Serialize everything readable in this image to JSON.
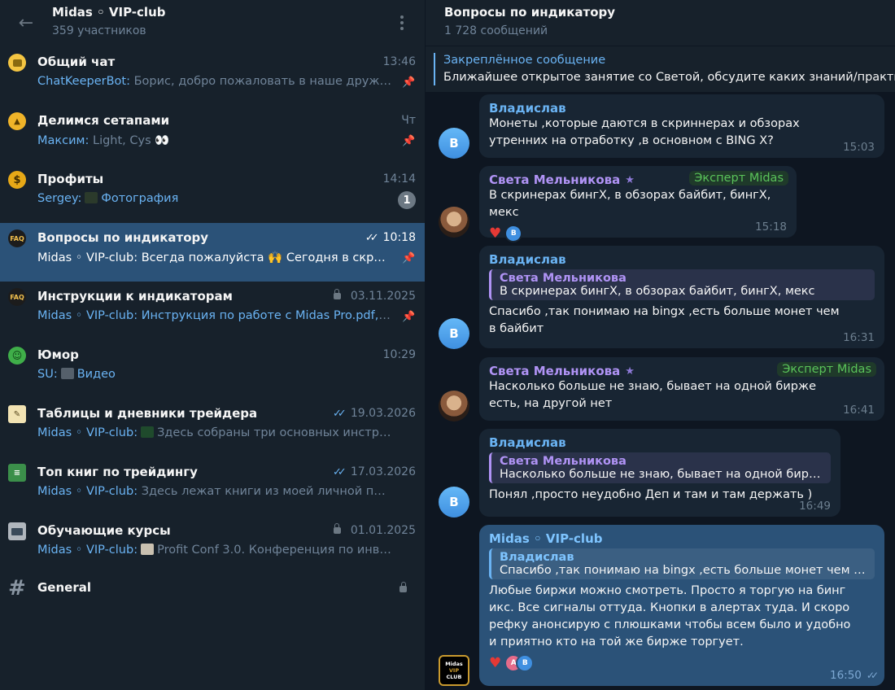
{
  "group": {
    "title": "Midas ◦ VIP-club",
    "members": "359 участников"
  },
  "topics": [
    {
      "icon": "speech-bubble-icon",
      "title": "Общий чат",
      "time": "13:46",
      "sender": "ChatKeeperBot:",
      "text": " Борис, добро пожаловать в наше дружно…",
      "pinned": true
    },
    {
      "icon": "bell-icon",
      "title": "Делимся сетапами",
      "time": "Чт",
      "sender": "Максим:",
      "text": " Light, Cys 👀",
      "pinned": true
    },
    {
      "icon": "dollar-coin-icon",
      "title": "Профиты",
      "time": "14:14",
      "sender": "Sergey:",
      "text": "Фотография",
      "badge": "1"
    },
    {
      "icon": "faq-icon",
      "title": "Вопросы по индикатору",
      "time": "10:18",
      "sender": "Midas ◦ VIP-club:",
      "text": " Всегда пожалуйста 🙌 Сегодня в скринер…",
      "pinned": true,
      "read": true
    },
    {
      "icon": "faq-icon",
      "title": "Инструкции к индикаторам",
      "time": "03.11.2025",
      "sender": "Midas ◦ VIP-club:",
      "text": " Инструкция по работе с Midas Pro.pdf, На…",
      "pinned": true,
      "locked": true
    },
    {
      "icon": "smiley-icon",
      "title": "Юмор",
      "time": "10:29",
      "sender": "SU:",
      "text": "Видео"
    },
    {
      "icon": "memo-icon",
      "title": "Таблицы и дневники трейдера",
      "time": "19.03.2026",
      "sender": "Midas ◦ VIP-club:",
      "text": "Здесь собраны три основных инструмент…",
      "read": true
    },
    {
      "icon": "books-icon",
      "title": "Топ книг по трейдингу",
      "time": "17.03.2026",
      "sender": "Midas ◦ VIP-club:",
      "text": " Здесь лежат книги из моей личной подборки …",
      "read": true
    },
    {
      "icon": "computer-icon",
      "title": "Обучающие курсы",
      "time": "01.01.2025",
      "sender": "Midas ◦ VIP-club:",
      "text": "Profit Conf 3.0. Конференция по инвестиц…",
      "locked": true
    }
  ],
  "general": {
    "title": "General"
  },
  "chat": {
    "title": "Вопросы по индикатору",
    "subtitle": "1 728 сообщений",
    "pinned_label": "Закреплённое сообщение",
    "pinned_text": "Ближайшее открытое занятие со Светой, обсудите каких знаний/практики в"
  },
  "messages": [
    {
      "name": "Владислав",
      "avatar_letter": "В",
      "text": "Монеты ,которые даются в скриннерах и обзорах утренних на отработку ,в основном с BING X?",
      "time": "15:03"
    },
    {
      "name": "Света Мельникова",
      "role": "Эксперт Midas",
      "text": "В скринерах бингХ, в обзорах байбит, бингХ, мекс",
      "time": "15:18",
      "reaction_users": [
        "В"
      ]
    },
    {
      "name": "Владислав",
      "avatar_letter": "В",
      "reply_name": "Света Мельникова",
      "reply_text": "В скринерах бингХ, в обзорах байбит, бингХ, мекс",
      "text": "Спасибо ,так понимаю на bingx ,есть больше монет чем в байбит",
      "time": "16:31"
    },
    {
      "name": "Света Мельникова",
      "role": "Эксперт Midas",
      "text": "Насколько больше не знаю, бывает на одной бирже есть, на другой нет",
      "time": "16:41"
    },
    {
      "name": "Владислав",
      "avatar_letter": "В",
      "reply_name": "Света Мельникова",
      "reply_text": "Насколько больше не знаю, бывает на одной бирже …",
      "text": "Понял ,просто неудобно Деп и там и там держать )",
      "time": "16:49"
    },
    {
      "name": "Midas ◦ VIP-club",
      "avatar_text": [
        "Midas",
        "VIP",
        "CLUB"
      ],
      "reply_name": "Владислав",
      "reply_text": "Спасибо ,так понимаю на bingx ,есть больше монет чем в ба…",
      "text": "Любые биржи можно смотреть. Просто я торгую на бинг икс. Все сигналы оттуда. Кнопки в алертах туда. И скоро рефку анонсирую с плюшками чтобы всем было и удобно и приятно кто на той же бирже торгует.",
      "time": "16:50",
      "reaction_users": [
        "А",
        "В"
      ]
    }
  ],
  "colors": {
    "sidebar_bg": "#17212b",
    "chat_bg": "#0e1621",
    "active_topic": "#2b5278",
    "link_blue": "#6ab3f3",
    "expert_green": "#5ac35a",
    "name_purple": "#b093f5"
  }
}
